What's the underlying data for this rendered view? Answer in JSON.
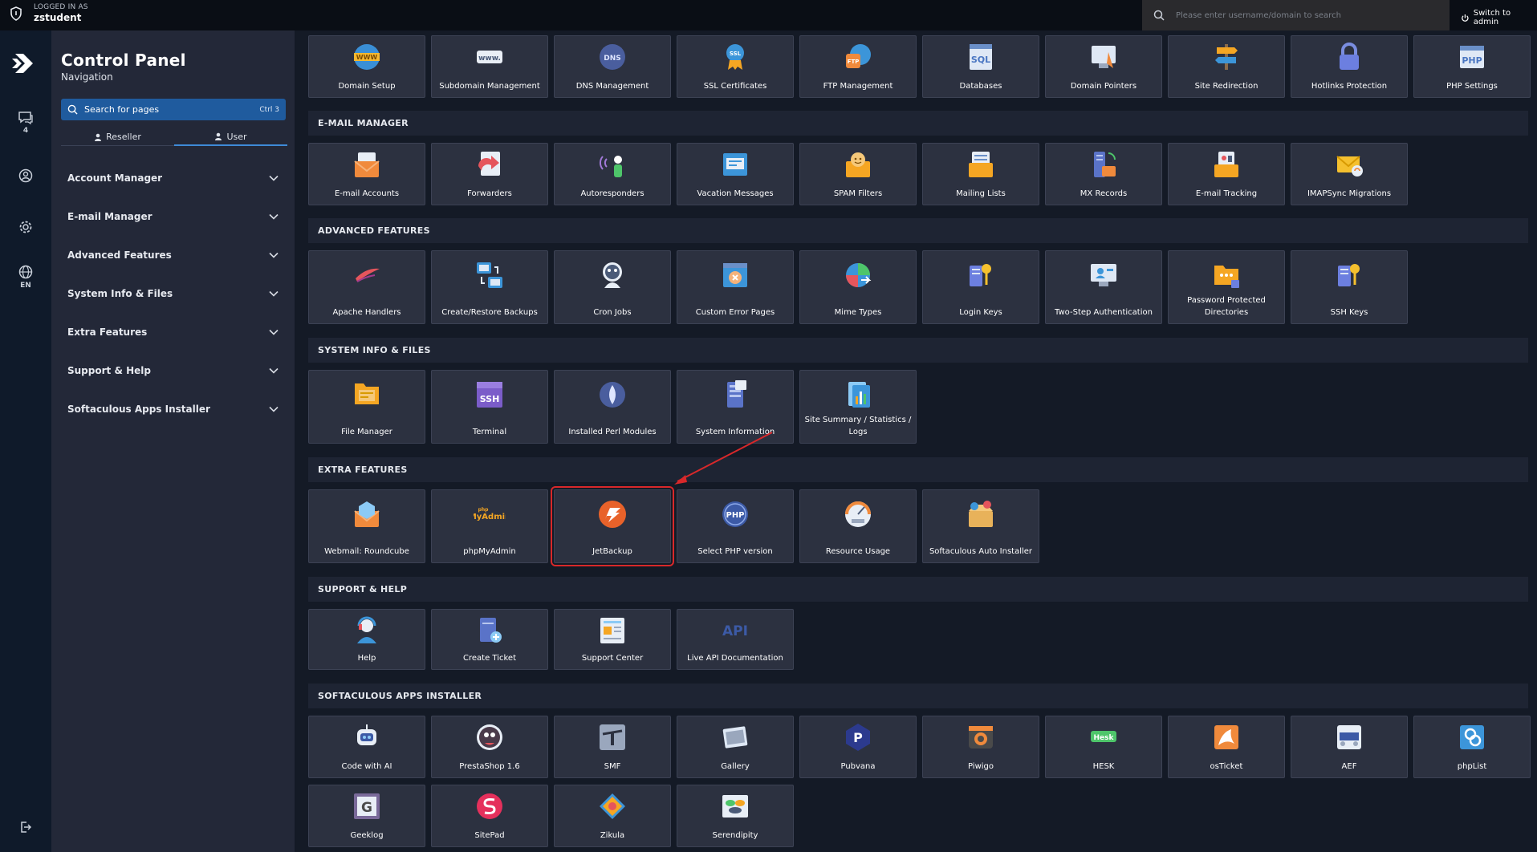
{
  "topbar": {
    "logged_in_label": "LOGGED IN AS",
    "username": "zstudent",
    "search_placeholder": "Please enter username/domain to search",
    "switch_label": "Switch to admin"
  },
  "rail": {
    "chat_count": "4",
    "language": "EN"
  },
  "sidebar": {
    "title": "Control Panel",
    "subtitle": "Navigation",
    "search_label": "Search for pages",
    "search_shortcut": "Ctrl 3",
    "roles": [
      "Reseller",
      "User"
    ],
    "menu": [
      "Account Manager",
      "E-mail Manager",
      "Advanced Features",
      "System Info & Files",
      "Extra Features",
      "Support & Help",
      "Softaculous Apps Installer"
    ]
  },
  "sections": {
    "domain": {
      "items": [
        "Domain Setup",
        "Subdomain Management",
        "DNS Management",
        "SSL Certificates",
        "FTP Management",
        "Databases",
        "Domain Pointers",
        "Site Redirection",
        "Hotlinks Protection",
        "PHP Settings"
      ]
    },
    "email": {
      "title": "E-MAIL MANAGER",
      "items": [
        "E-mail Accounts",
        "Forwarders",
        "Autoresponders",
        "Vacation Messages",
        "SPAM Filters",
        "Mailing Lists",
        "MX Records",
        "E-mail Tracking",
        "IMAPSync Migrations"
      ]
    },
    "advanced": {
      "title": "ADVANCED FEATURES",
      "items": [
        "Apache Handlers",
        "Create/Restore Backups",
        "Cron Jobs",
        "Custom Error Pages",
        "Mime Types",
        "Login Keys",
        "Two-Step Authentication",
        "Password Protected Directories",
        "SSH Keys"
      ]
    },
    "system": {
      "title": "SYSTEM INFO & FILES",
      "items": [
        "File Manager",
        "Terminal",
        "Installed Perl Modules",
        "System Information",
        "Site Summary / Statistics / Logs"
      ]
    },
    "extra": {
      "title": "EXTRA FEATURES",
      "items": [
        "Webmail: Roundcube",
        "phpMyAdmin",
        "JetBackup",
        "Select PHP version",
        "Resource Usage",
        "Softaculous Auto Installer"
      ]
    },
    "support": {
      "title": "SUPPORT & HELP",
      "items": [
        "Help",
        "Create Ticket",
        "Support Center",
        "Live API Documentation"
      ]
    },
    "softaculous": {
      "title": "SOFTACULOUS APPS INSTALLER",
      "items": [
        "Code with AI",
        "PrestaShop 1.6",
        "SMF",
        "Gallery",
        "Pubvana",
        "Piwigo",
        "HESK",
        "osTicket",
        "AEF",
        "phpList",
        "Geeklog",
        "SitePad",
        "Zikula",
        "Serendipity"
      ]
    }
  },
  "icon_text": {
    "www": "WWW",
    "dns": "DNS",
    "ssl": "SSL",
    "ftp": "FTP",
    "sql": "SQL",
    "php": "PHP",
    "ssh": "SSH",
    "api": "API",
    "pma_php": "php",
    "pma_name": "MyAdmin",
    "hesk": "Hesk"
  },
  "colors": {
    "accent": "#1f5b9e",
    "highlight": "#d8282a",
    "jetbackup": "#e8622a"
  }
}
